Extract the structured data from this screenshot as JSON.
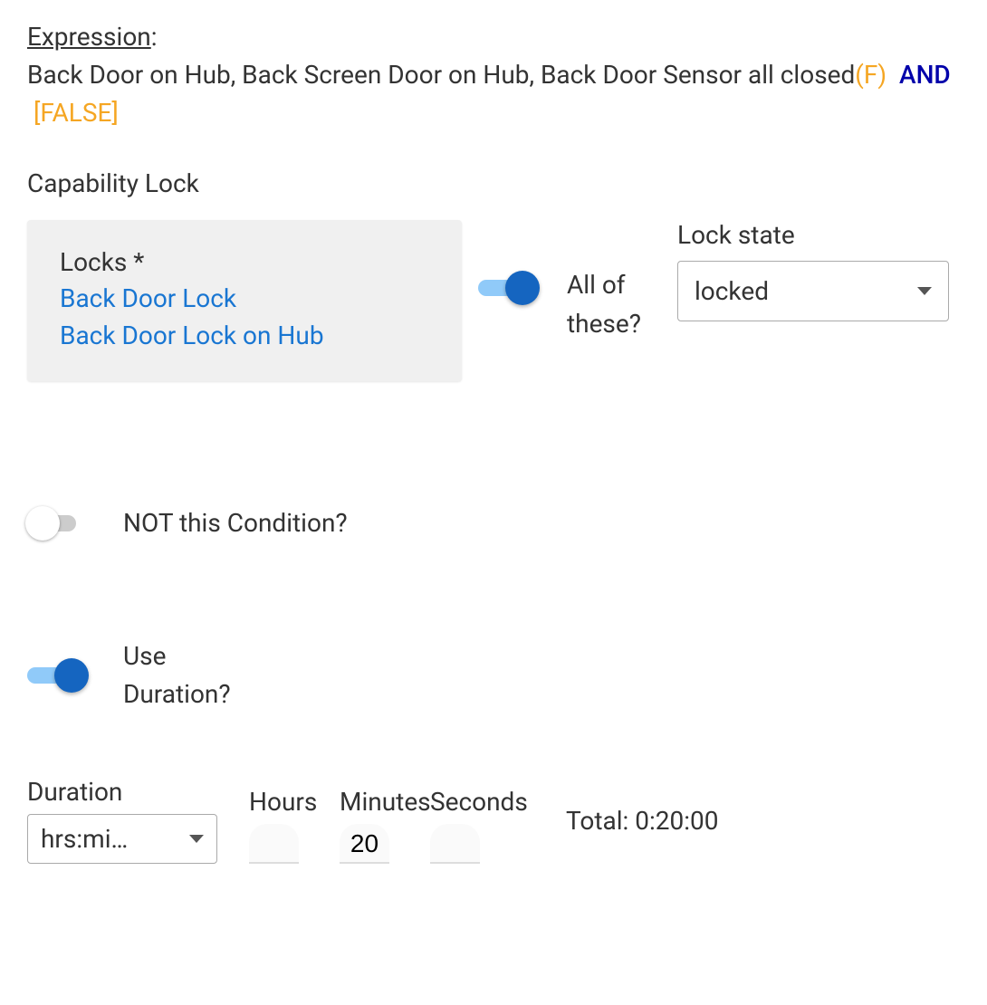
{
  "expression": {
    "label": "Expression",
    "colon": ":",
    "text": "Back Door on Hub, Back Screen Door on Hub, Back Door Sensor all closed",
    "f": "(F)",
    "and": "AND",
    "false": "[FALSE]"
  },
  "capability_title": "Capability Lock",
  "locks": {
    "title": "Locks *",
    "items": [
      "Back Door Lock",
      "Back Door Lock on Hub"
    ]
  },
  "all_of_these_label": "All of these?",
  "lock_state": {
    "label": "Lock state",
    "value": "locked"
  },
  "not_condition_label": "NOT this Condition?",
  "use_duration_label": "Use Duration?",
  "duration": {
    "label": "Duration",
    "format_value": "hrs:mi…",
    "hours_label": "Hours",
    "minutes_label": "Minutes",
    "seconds_label": "Seconds",
    "hours": "",
    "minutes": "20",
    "seconds": "",
    "total_prefix": "Total: ",
    "total_value": "0:20:00"
  },
  "toggles": {
    "all_of_these": true,
    "not_condition": false,
    "use_duration": true
  }
}
